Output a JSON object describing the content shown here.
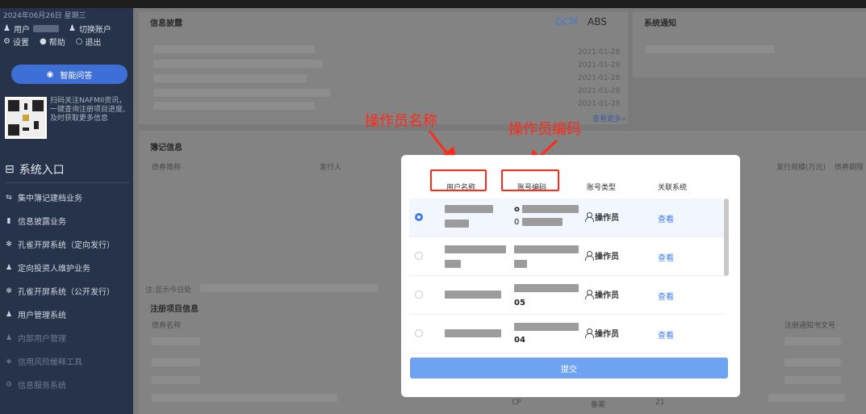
{
  "sidebar": {
    "date": "2024年06月26日 星期三",
    "user_label": "用户",
    "switch_account": "切换账户",
    "settings": "设置",
    "help": "帮助",
    "logout": "退出",
    "ai_button": "智能问答",
    "qr_text": "扫码关注NAFMII资讯，一键查询注册项目进度,及时获取更多信息",
    "entry_title": "系统入口",
    "menu": [
      {
        "label": "集中簿记建档业务",
        "icon": "swap-icon",
        "dim": false
      },
      {
        "label": "信息披露业务",
        "icon": "bar-chart-icon",
        "dim": false
      },
      {
        "label": "孔雀开屏系统（定向发行）",
        "icon": "peacock-icon",
        "dim": false
      },
      {
        "label": "定向投资人维护业务",
        "icon": "person-icon",
        "dim": false
      },
      {
        "label": "孔雀开屏系统（公开发行）",
        "icon": "peacock-icon",
        "dim": false
      },
      {
        "label": "用户管理系统",
        "icon": "person-icon",
        "dim": false
      },
      {
        "label": "内部用户管理",
        "icon": "person-icon",
        "dim": true
      },
      {
        "label": "信用风险缓释工具",
        "icon": "shield-icon",
        "dim": true
      },
      {
        "label": "信息服务系统",
        "icon": "gear-icon",
        "dim": true
      }
    ]
  },
  "disclosure": {
    "title": "信息披露",
    "tabs": [
      "DCM",
      "ABS"
    ],
    "dates": [
      "2021-01-28",
      "2021-01-28",
      "2021-01-28",
      "2021-01-28",
      "2021-01-28"
    ],
    "more": "查看更多»"
  },
  "notice": {
    "title": "系统通知"
  },
  "bookkeeping": {
    "title": "簿记信息",
    "cols": [
      "债券简称",
      "发行人",
      "发行规模(万元)",
      "债券期限"
    ],
    "footer": "注:显示今日处"
  },
  "registration": {
    "title": "注册项目信息",
    "cols": [
      "债券名称",
      "注册通知书文号"
    ],
    "last_row": {
      "type": "CP",
      "status": "备案",
      "num": "21"
    }
  },
  "annotations": {
    "username_label": "操作员名称",
    "usercode_label": "操作员编码"
  },
  "modal": {
    "headers": [
      "用户名称",
      "账号编码",
      "账号类型",
      "关联系统"
    ],
    "rows": [
      {
        "name_visible": "",
        "code_visible": "o",
        "code_sub": "0",
        "type": "操作员",
        "link": "查看",
        "selected": true
      },
      {
        "name_visible": "",
        "code_visible": "",
        "code_sub": "",
        "type": "操作员",
        "link": "查看",
        "selected": false
      },
      {
        "name_visible": "",
        "code_visible": "",
        "code_sub": "05",
        "type": "操作员",
        "link": "查看",
        "selected": false
      },
      {
        "name_visible": "",
        "code_visible": "",
        "code_sub": "04",
        "type": "操作员",
        "link": "查看",
        "selected": false
      }
    ],
    "submit": "提交"
  }
}
